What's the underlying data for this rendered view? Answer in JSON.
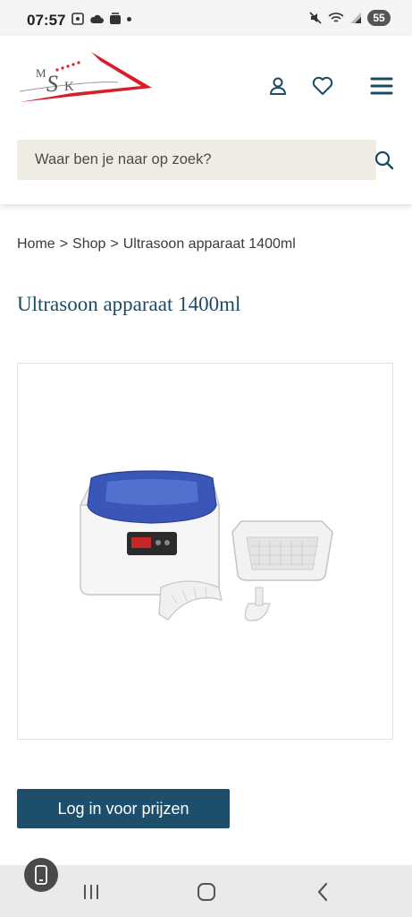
{
  "status_bar": {
    "time": "07:57",
    "battery": "55",
    "left_icons": [
      "screenshot-icon",
      "cloud-icon",
      "stack-icon",
      "dot"
    ],
    "right_icons": [
      "mute-icon",
      "wifi-icon",
      "signal-icon"
    ]
  },
  "header": {
    "logo_icon": "msk-logo",
    "icons": [
      "account-icon",
      "heart-icon",
      "menu-icon"
    ],
    "search": {
      "placeholder": "Waar ben je naar op zoek?",
      "value": ""
    }
  },
  "breadcrumb": {
    "items": [
      "Home",
      "Shop",
      "Ultrasoon apparaat 1400ml"
    ],
    "separator": ">"
  },
  "product": {
    "title": "Ultrasoon apparaat 1400ml",
    "image_icon": "ultrasonic-cleaner-image",
    "cta_label": "Log in voor prijzen"
  },
  "colors": {
    "brand_dark": "#1d4f6c",
    "title": "#1d4a63",
    "search_bg": "#efece3",
    "logo_red": "#d81e2a"
  },
  "nav_bar": {
    "buttons": [
      "recent-apps",
      "home",
      "back"
    ]
  }
}
